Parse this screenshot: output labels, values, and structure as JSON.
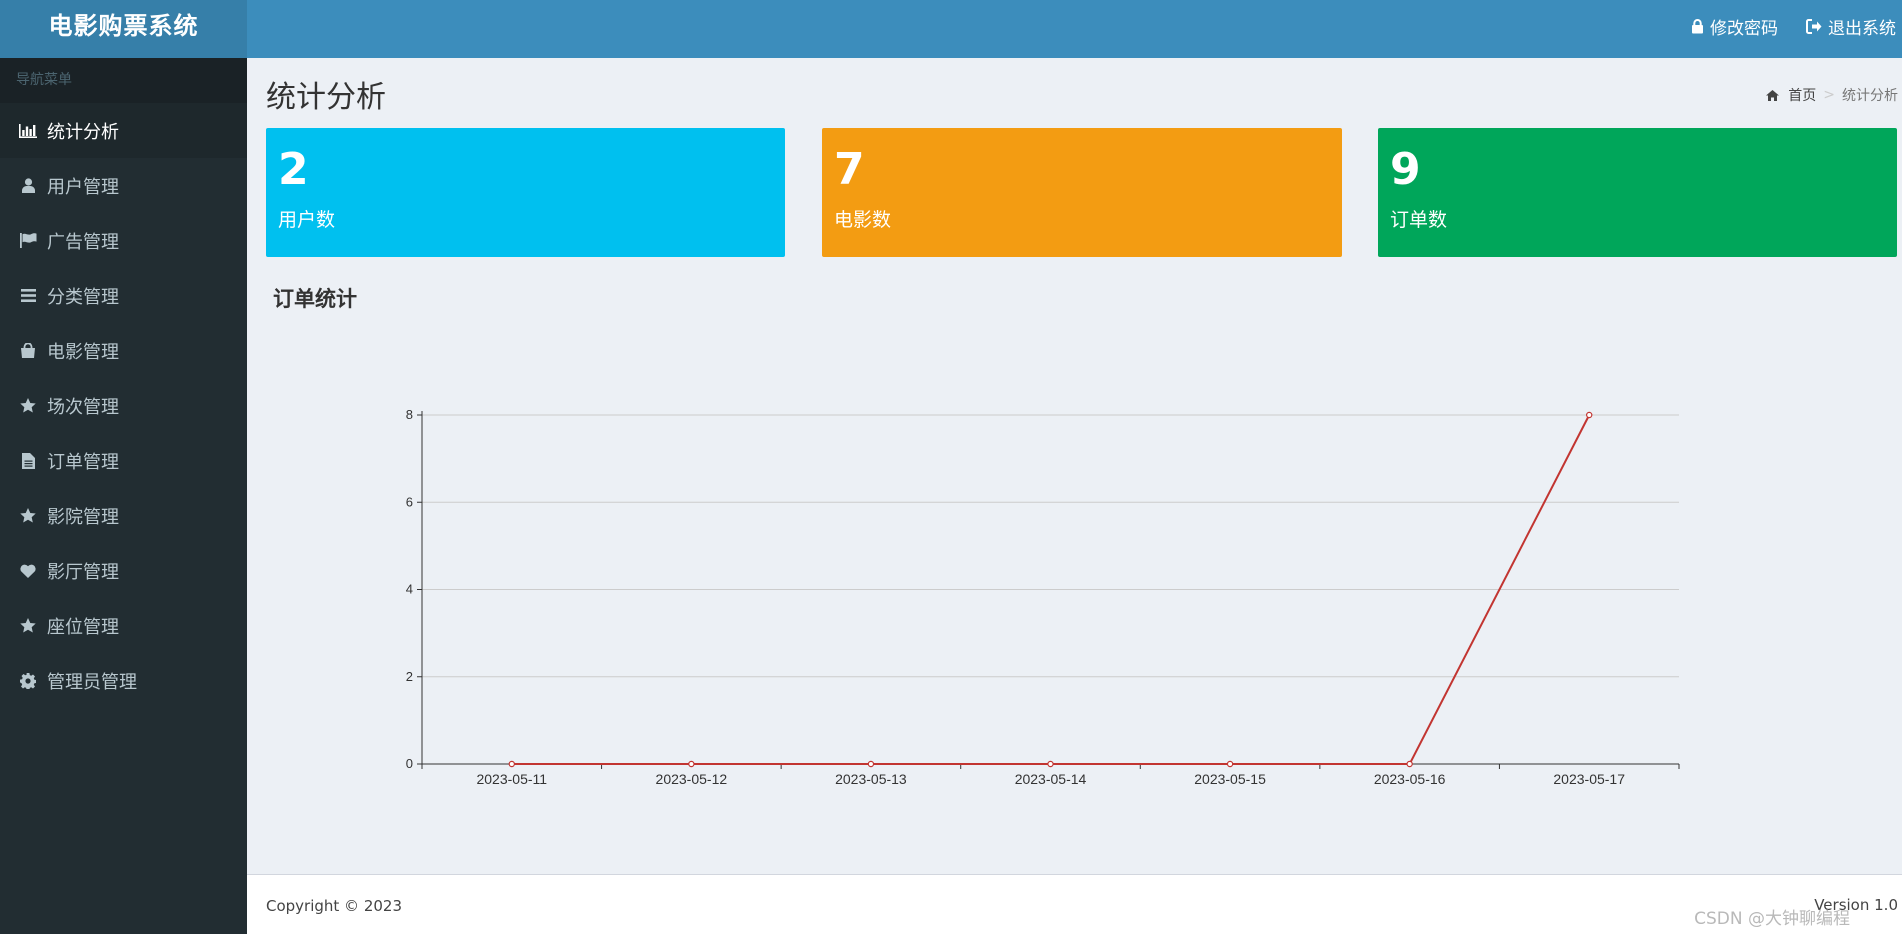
{
  "app": {
    "title": "电影购票系统",
    "change_password": "修改密码",
    "logout": "退出系统"
  },
  "sidebar": {
    "header": "导航菜单",
    "items": [
      {
        "label": "统计分析",
        "icon": "bar-chart-icon",
        "active": true
      },
      {
        "label": "用户管理",
        "icon": "user-icon"
      },
      {
        "label": "广告管理",
        "icon": "flag-icon"
      },
      {
        "label": "分类管理",
        "icon": "list-icon"
      },
      {
        "label": "电影管理",
        "icon": "shopping-bag-icon"
      },
      {
        "label": "场次管理",
        "icon": "star-icon"
      },
      {
        "label": "订单管理",
        "icon": "file-icon"
      },
      {
        "label": "影院管理",
        "icon": "star-icon"
      },
      {
        "label": "影厅管理",
        "icon": "heart-icon"
      },
      {
        "label": "座位管理",
        "icon": "star-icon"
      },
      {
        "label": "管理员管理",
        "icon": "gear-icon"
      }
    ]
  },
  "page": {
    "title": "统计分析",
    "breadcrumb": {
      "home": "首页",
      "sep": ">",
      "current": "统计分析"
    }
  },
  "stats": [
    {
      "value": "2",
      "label": "用户数",
      "color": "#00c0ef"
    },
    {
      "value": "7",
      "label": "电影数",
      "color": "#f39c12"
    },
    {
      "value": "9",
      "label": "订单数",
      "color": "#00a65a"
    }
  ],
  "section": {
    "title": "订单统计"
  },
  "chart_data": {
    "type": "line",
    "x": [
      "2023-05-11",
      "2023-05-12",
      "2023-05-13",
      "2023-05-14",
      "2023-05-15",
      "2023-05-16",
      "2023-05-17"
    ],
    "series": [
      {
        "values": [
          0,
          0,
          0,
          0,
          0,
          0,
          8
        ],
        "color": "#c23531"
      }
    ],
    "ylim": [
      0,
      8
    ],
    "yticks": [
      0,
      2,
      4,
      6,
      8
    ],
    "grid": true
  },
  "footer": {
    "copyright": "Copyright © 2023",
    "version": "Version 1.0",
    "watermark": "CSDN @大钟聊编程"
  }
}
